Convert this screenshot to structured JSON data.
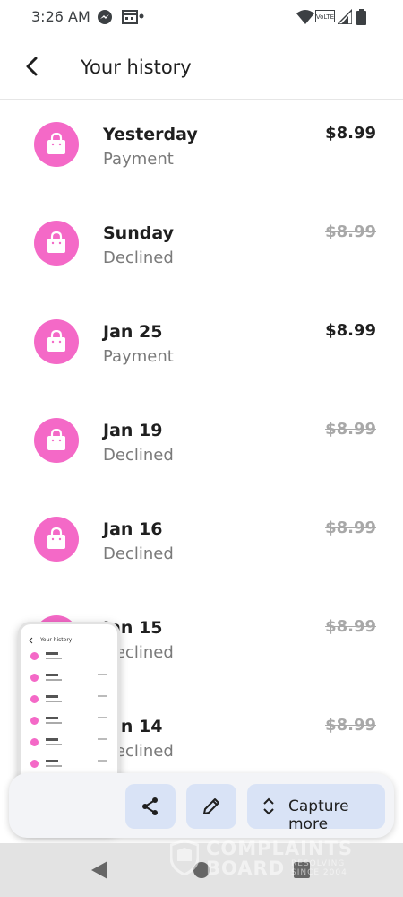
{
  "status_bar": {
    "time": "3:26 AM",
    "icons": [
      "messenger-icon",
      "calendar-icon",
      "dot-icon",
      "wifi-icon",
      "volte-icon",
      "signal-icon",
      "battery-icon"
    ],
    "volte_label": "VoLTE"
  },
  "header": {
    "title": "Your history",
    "back_icon": "back-arrow-icon"
  },
  "transactions": [
    {
      "date": "Yesterday",
      "status": "Payment",
      "amount": "$8.99",
      "declined": false
    },
    {
      "date": "Sunday",
      "status": "Declined",
      "amount": "$8.99",
      "declined": true
    },
    {
      "date": "Jan 25",
      "status": "Payment",
      "amount": "$8.99",
      "declined": false
    },
    {
      "date": "Jan 19",
      "status": "Declined",
      "amount": "$8.99",
      "declined": true
    },
    {
      "date": "Jan 16",
      "status": "Declined",
      "amount": "$8.99",
      "declined": true
    },
    {
      "date": "Jan 15",
      "status": "Declined",
      "amount": "$8.99",
      "declined": true
    },
    {
      "date": "Jan 14",
      "status": "Declined",
      "amount": "$8.99",
      "declined": true
    }
  ],
  "screenshot_toolbar": {
    "share_icon": "share-icon",
    "edit_icon": "pencil-icon",
    "capture_more_label": "Capture more",
    "capture_more_icon": "expand-vertical-icon"
  },
  "thumbnail": {
    "title": "Your history"
  },
  "nav_bar": {
    "buttons": [
      "back-triangle-icon",
      "home-circle-icon",
      "recents-square-icon"
    ]
  },
  "watermark": {
    "line1": "COMPLAINTS",
    "line2": "BOARD",
    "tagline": "RESOLVING SINCE 2004"
  },
  "colors": {
    "avatar": "#f469c7",
    "accent_button": "#d9e3f6",
    "declined_text": "#a8a8a8"
  }
}
